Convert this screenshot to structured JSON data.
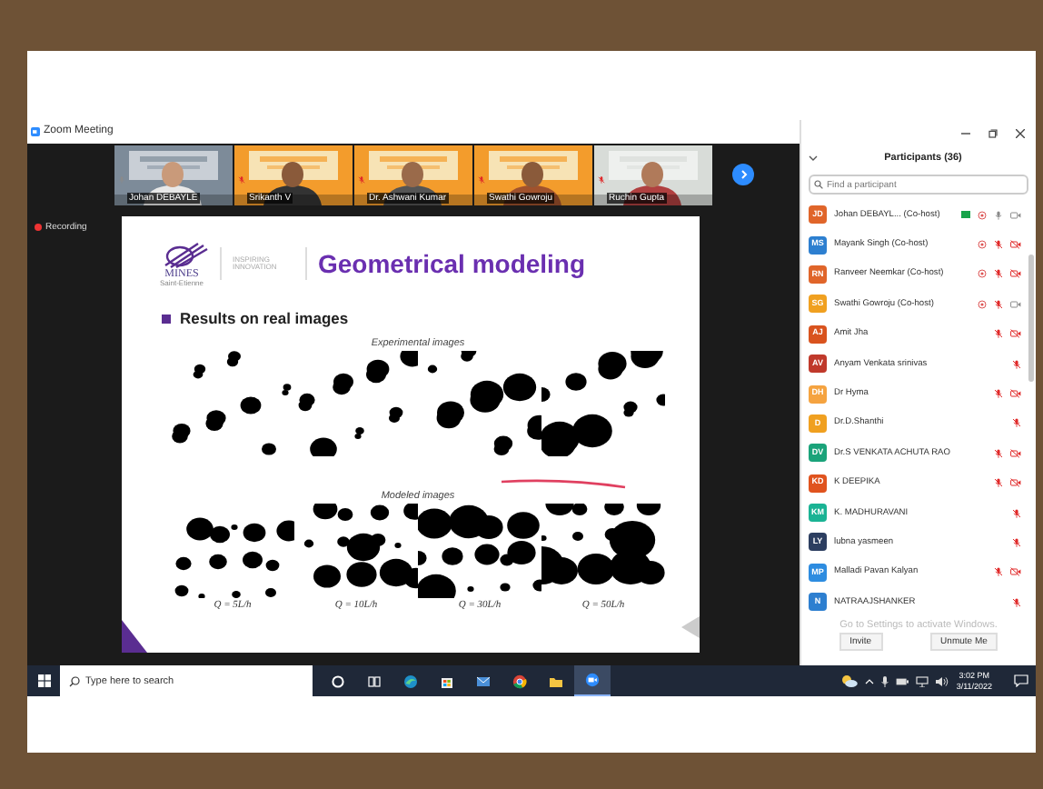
{
  "window": {
    "title": "Zoom Meeting"
  },
  "thumbnails": [
    {
      "name": "Johan DEBAYLE",
      "muted": false
    },
    {
      "name": "Srikanth V",
      "muted": true
    },
    {
      "name": "Dr. Ashwani Kumar",
      "muted": true
    },
    {
      "name": "Swathi Gowroju",
      "muted": true
    },
    {
      "name": "Ruchin Gupta",
      "muted": true
    }
  ],
  "recording": {
    "label": "Recording"
  },
  "slide": {
    "logo_name": "MINES",
    "logo_sub": "Saint-Etienne",
    "partner": "INSPIRING INNOVATION",
    "title": "Geometrical modeling",
    "bullet": "Results on real images",
    "experimental_caption": "Experimental images",
    "modeled_caption": "Modeled images",
    "q_labels": [
      "Q = 5L/h",
      "Q = 10L/h",
      "Q = 30L/h",
      "Q = 50L/h"
    ]
  },
  "participants": {
    "title": "Participants (36)",
    "search": {
      "placeholder": "Find a participant"
    },
    "items": [
      {
        "initials": "JD",
        "name": "Johan DEBAYL... (Co-host)",
        "color": "#e0652a",
        "badge": true,
        "extra_icon": true,
        "muted": false,
        "video_off": false
      },
      {
        "initials": "MS",
        "name": "Mayank Singh (Co-host)",
        "color": "#2d7fd0",
        "badge": false,
        "extra_icon": true,
        "muted": true,
        "video_off": true
      },
      {
        "initials": "RN",
        "name": "Ranveer Neemkar (Co-host)",
        "color": "#e0652a",
        "badge": false,
        "extra_icon": true,
        "muted": true,
        "video_off": true
      },
      {
        "initials": "SG",
        "name": "Swathi Gowroju (Co-host)",
        "color": "#f0a020",
        "badge": false,
        "extra_icon": true,
        "muted": true,
        "video_off": false
      },
      {
        "initials": "AJ",
        "name": "Amit Jha",
        "color": "#d9531e",
        "badge": false,
        "extra_icon": false,
        "muted": true,
        "video_off": true
      },
      {
        "initials": "AV",
        "name": "Anyam Venkata srinivas",
        "color": "#c0392b",
        "badge": false,
        "extra_icon": false,
        "muted": true
      },
      {
        "initials": "DH",
        "name": "Dr Hyma",
        "color": "#f5a340",
        "badge": false,
        "extra_icon": false,
        "muted": true,
        "video_off": true
      },
      {
        "initials": "D",
        "name": "Dr.D.Shanthi",
        "color": "#f0a020",
        "badge": false,
        "extra_icon": false,
        "muted": true
      },
      {
        "initials": "DV",
        "name": "Dr.S VENKATA ACHUTA RAO",
        "color": "#1aa37a",
        "badge": false,
        "extra_icon": false,
        "muted": true,
        "video_off": true
      },
      {
        "initials": "KD",
        "name": "K DEEPIKA",
        "color": "#e0531e",
        "badge": false,
        "extra_icon": false,
        "muted": true,
        "video_off": true
      },
      {
        "initials": "KM",
        "name": "K. MADHURAVANI",
        "color": "#1ab394",
        "badge": false,
        "extra_icon": false,
        "muted": true
      },
      {
        "initials": "LY",
        "name": "lubna yasmeen",
        "color": "#2c3e60",
        "badge": false,
        "extra_icon": false,
        "muted": true
      },
      {
        "initials": "MP",
        "name": "Malladi Pavan Kalyan",
        "color": "#2d8ce0",
        "badge": false,
        "extra_icon": false,
        "muted": true,
        "video_off": true
      },
      {
        "initials": "N",
        "name": "NATRAAJSHANKER",
        "color": "#2d7fd0",
        "badge": false,
        "extra_icon": false,
        "muted": true
      }
    ],
    "activation_notice": "Go to Settings to activate Windows.",
    "buttons": [
      "Invite",
      "Unmute Me"
    ]
  },
  "taskbar": {
    "search": {
      "placeholder": "Type here to search"
    },
    "apps": [
      {
        "kind": "cortana",
        "selected": false
      },
      {
        "kind": "taskview",
        "selected": false
      },
      {
        "kind": "edge",
        "selected": false
      },
      {
        "kind": "store",
        "selected": false
      },
      {
        "kind": "mail",
        "selected": false
      },
      {
        "kind": "chrome",
        "selected": false
      },
      {
        "kind": "explorer",
        "selected": false
      },
      {
        "kind": "zoom",
        "selected": true
      }
    ],
    "time": "3:02 PM",
    "date": "3/11/2022"
  }
}
